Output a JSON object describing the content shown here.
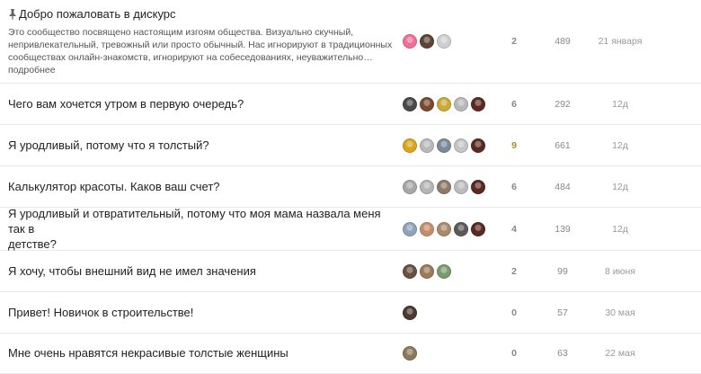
{
  "topics": [
    {
      "title": "Добро пожаловать в дискурс",
      "pinned": true,
      "excerpt_lines": [
        "Это сообщество посвящено настоящим изгоям общества. Визуально скучный,",
        "непривлекательный, тревожный или просто обычный. Нас игнорируют в традиционных",
        "сообществах онлайн-знакомств, игнорируют на собеседованиях, неуважительно…"
      ],
      "more": "подробнее",
      "replies": "2",
      "views": "489",
      "activity": "21 января",
      "avatar_colors": [
        "#ef6f9a",
        "#5a4536",
        "#cfcfcf"
      ]
    },
    {
      "title": "Чего вам хочется утром в первую очередь?",
      "replies": "6",
      "views": "292",
      "activity": "12д",
      "avatar_colors": [
        "#4a4a4a",
        "#7a4a30",
        "#c9a93a",
        "#b8b8b8",
        "#5a2a22"
      ]
    },
    {
      "title": "Я уродливый, потому что я толстый?",
      "replies": "9",
      "views": "661",
      "activity": "12д",
      "hot": true,
      "avatar_colors": [
        "#d9a51e",
        "#b9b9b9",
        "#7a8a9a",
        "#c4c4c4",
        "#5a2a22"
      ]
    },
    {
      "title": "Калькулятор красоты. Каков ваш счет?",
      "replies": "6",
      "views": "484",
      "activity": "12д",
      "avatar_colors": [
        "#a8a8a8",
        "#b5b5b5",
        "#8c7a6a",
        "#bcbcbc",
        "#5a2a22"
      ]
    },
    {
      "title_lines": [
        "Я уродливый и отвратительный, потому что моя мама назвала меня так в",
        "детстве?"
      ],
      "replies": "4",
      "views": "139",
      "activity": "12д",
      "avatar_colors": [
        "#8fa3b8",
        "#c58d6a",
        "#a88a6e",
        "#5a5a5a",
        "#5a2a22"
      ]
    },
    {
      "title": "Я хочу, чтобы внешний вид не имел значения",
      "replies": "2",
      "views": "99",
      "activity": "8 июня",
      "avatar_colors": [
        "#6a5040",
        "#9a7a5a",
        "#7a9a6a"
      ]
    },
    {
      "title": "Привет! Новичок в строительстве!",
      "replies": "0",
      "views": "57",
      "activity": "30 мая",
      "avatar_colors": [
        "#4a3a30"
      ]
    },
    {
      "title": "Мне очень нравятся некрасивые толстые женщины",
      "replies": "0",
      "views": "63",
      "activity": "22 мая",
      "avatar_colors": [
        "#8a7a5a"
      ]
    }
  ]
}
